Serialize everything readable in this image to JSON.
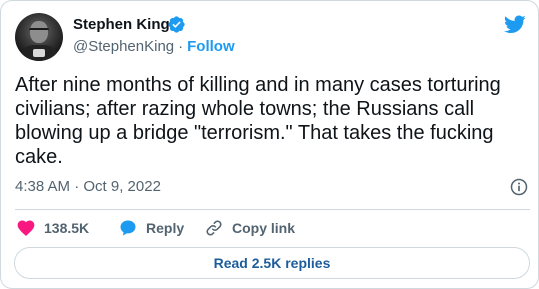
{
  "author": {
    "name": "Stephen King",
    "handle": "@StephenKing",
    "separator": "·",
    "follow_label": "Follow"
  },
  "tweet": {
    "text": "After nine months of killing and in many cases torturing civilians; after razing whole towns; the Russians call blowing up a bridge \"terrorism.\" That takes the fucking cake.",
    "timestamp": "4:38 AM · Oct 9, 2022"
  },
  "actions": {
    "likes_count": "138.5K",
    "reply_label": "Reply",
    "copy_link_label": "Copy link"
  },
  "read_replies_label": "Read 2.5K replies",
  "colors": {
    "brand_blue": "#1d9bf0",
    "like_pink": "#f91880",
    "text_dark": "#0f1419",
    "text_muted": "#536471",
    "border": "#cfd9de"
  },
  "icons": [
    "verified-badge-icon",
    "twitter-bird-icon",
    "info-icon",
    "heart-icon",
    "reply-bubble-icon",
    "link-icon"
  ]
}
